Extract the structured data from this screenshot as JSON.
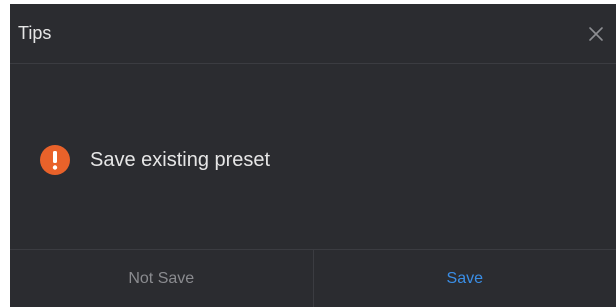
{
  "dialog": {
    "title": "Tips",
    "message": "Save existing preset",
    "buttons": {
      "not_save": "Not Save",
      "save": "Save"
    }
  },
  "icons": {
    "close": "close-icon",
    "warning": "warning-icon"
  },
  "colors": {
    "background": "#2b2c30",
    "divider": "#3b3c41",
    "text": "#e6e6e6",
    "muted_text": "#8a8b8f",
    "accent": "#3a8ee6",
    "warning": "#e9622a"
  }
}
